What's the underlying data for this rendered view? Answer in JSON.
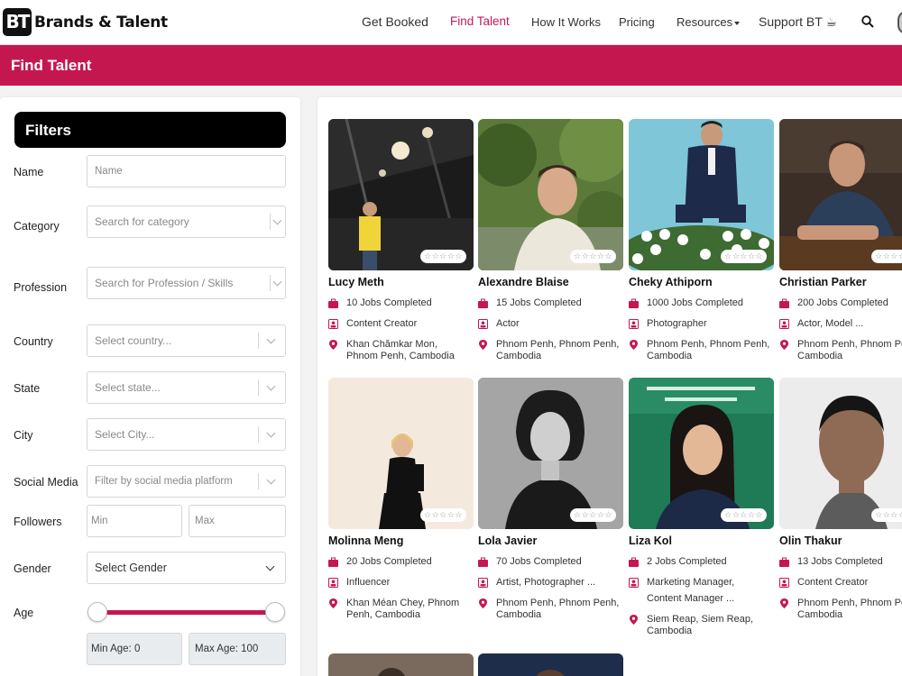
{
  "brand": {
    "logo_letters": "BT",
    "name": "Brands & Talent"
  },
  "nav": {
    "get_booked": "Get Booked",
    "find_talent": "Find Talent",
    "how_it_works": "How It Works",
    "pricing": "Pricing",
    "resources": "Resources",
    "support": "Support BT",
    "accent_color": "#c5174f"
  },
  "page": {
    "title": "Find Talent"
  },
  "filters": {
    "title": "Filters",
    "name_label": "Name",
    "name_placeholder": "Name",
    "category_label": "Category",
    "category_placeholder": "Search for category",
    "profession_label": "Profession",
    "profession_placeholder": "Search for Profession / Skills",
    "country_label": "Country",
    "country_placeholder": "Select country...",
    "state_label": "State",
    "state_placeholder": "Select state...",
    "city_label": "City",
    "city_placeholder": "Select City...",
    "social_label": "Social Media",
    "social_placeholder": "Filter by social media platform",
    "followers_label": "Followers",
    "followers_min": "Min",
    "followers_max": "Max",
    "gender_label": "Gender",
    "gender_value": "Select Gender",
    "age_label": "Age",
    "min_age": "Min Age: 0",
    "max_age": "Max Age: 100",
    "age_range": [
      0,
      100
    ]
  },
  "talents": [
    {
      "name": "Lucy Meth",
      "jobs": "10 Jobs Completed",
      "profession": "Content Creator",
      "location": [
        "Khan Chămkar Mon,",
        "Phnom Penh, Cambodia"
      ],
      "stars": "☆☆☆☆☆"
    },
    {
      "name": "Alexandre Blaise",
      "jobs": "15 Jobs Completed",
      "profession": "Actor",
      "location": [
        "Phnom Penh, Phnom Penh,",
        "Cambodia"
      ],
      "stars": "☆☆☆☆☆"
    },
    {
      "name": "Cheky Athiporn",
      "jobs": "1000 Jobs Completed",
      "profession": "Photographer",
      "location": [
        "Phnom Penh, Phnom Penh,",
        "Cambodia"
      ],
      "stars": "☆☆☆☆☆"
    },
    {
      "name": "Christian Parker",
      "jobs": "200 Jobs Completed",
      "profession": "Actor, Model ...",
      "location": [
        "Phnom Penh, Phnom Penh,",
        "Cambodia"
      ],
      "stars": "☆☆☆☆☆"
    },
    {
      "name": "Molinna Meng",
      "jobs": "20 Jobs Completed",
      "profession": "Influencer",
      "location": [
        "Khan Méan Chey, Phnom",
        "Penh, Cambodia"
      ],
      "stars": "☆☆☆☆☆"
    },
    {
      "name": "Lola Javier",
      "jobs": "70 Jobs Completed",
      "profession": "Artist, Photographer ...",
      "location": [
        "Phnom Penh, Phnom Penh,",
        "Cambodia"
      ],
      "stars": "☆☆☆☆☆"
    },
    {
      "name": "Liza Kol",
      "jobs": "2 Jobs Completed",
      "profession": "Marketing Manager,",
      "profession2": "Content Manager ...",
      "location": [
        "Siem Reap, Siem Reap,",
        "Cambodia"
      ],
      "stars": "☆☆☆☆☆"
    },
    {
      "name": "Olin Thakur",
      "jobs": "13 Jobs Completed",
      "profession": "Content Creator",
      "location": [
        "Phnom Penh, Phnom Penh,",
        "Cambodia"
      ],
      "stars": "☆☆☆☆☆"
    }
  ]
}
